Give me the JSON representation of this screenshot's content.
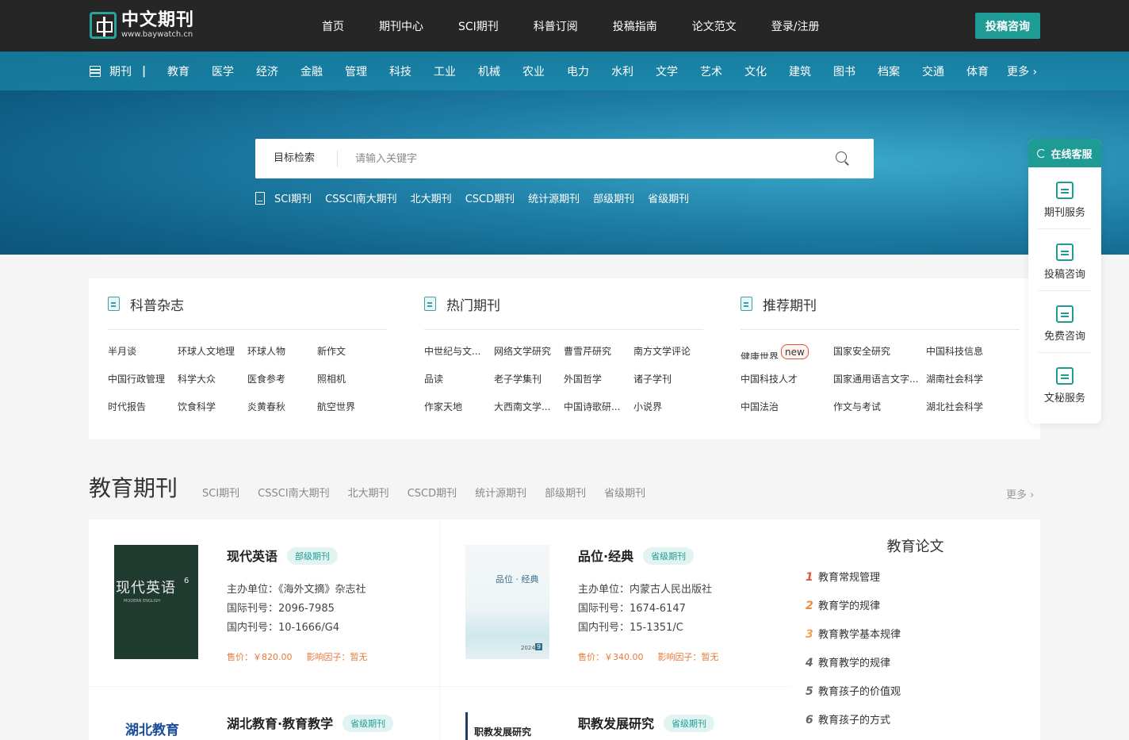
{
  "header": {
    "logo_title": "中文期刊",
    "logo_url": "www.baywatch.cn",
    "nav": [
      "首页",
      "期刊中心",
      "SCI期刊",
      "科普订阅",
      "投稿指南",
      "论文范文",
      "登录/注册"
    ],
    "consult_button": "投稿咨询",
    "accent_color": "#1e9b94"
  },
  "catbar": {
    "head": "期刊",
    "separator": "|",
    "items": [
      "教育",
      "医学",
      "经济",
      "金融",
      "管理",
      "科技",
      "工业",
      "机械",
      "农业",
      "电力",
      "水利",
      "文学",
      "艺术",
      "文化",
      "建筑",
      "图书",
      "档案",
      "交通",
      "体育"
    ],
    "more": "更多 ›"
  },
  "search": {
    "label": "目标检索",
    "placeholder": "请输入关键字",
    "quick_links": [
      "SCI期刊",
      "CSSCI南大期刊",
      "北大期刊",
      "CSCD期刊",
      "统计源期刊",
      "部级期刊",
      "省级期刊"
    ]
  },
  "columns": [
    {
      "title": "科普杂志",
      "items": [
        "半月谈",
        "环球人文地理",
        "环球人物",
        "新作文",
        "中国行政管理",
        "科学大众",
        "医食参考",
        "照相机",
        "时代报告",
        "饮食科学",
        "炎黄春秋",
        "航空世界"
      ]
    },
    {
      "title": "热门期刊",
      "items": [
        "中世纪与文...",
        "网络文学研究",
        "曹雪芹研究",
        "南方文学评论",
        "品读",
        "老子学集刊",
        "外国哲学",
        "诸子学刊",
        "作家天地",
        "大西南文学...",
        "中国诗歌研...",
        "小说界"
      ]
    },
    {
      "title": "推荐期刊",
      "items": [
        "健康世界",
        "国家安全研究",
        "中国科技信息",
        "中国科技人才",
        "国家通用语言文字...",
        "湖南社会科学",
        "中国法治",
        "作文与考试",
        "湖北社会科学"
      ],
      "new_badge": "new"
    }
  ],
  "section": {
    "title": "教育期刊",
    "tabs": [
      "SCI期刊",
      "CSSCI南大期刊",
      "北大期刊",
      "CSCD期刊",
      "统计源期刊",
      "部级期刊",
      "省级期刊"
    ],
    "more": "更多 ›"
  },
  "journals": [
    {
      "name": "现代英语",
      "tag": "部级期刊",
      "sponsor": "主办单位：《海外文摘》杂志社",
      "issn": "国际刊号：2096-7985",
      "cn": "国内刊号：10-1666/G4",
      "price": "售价：￥820.00",
      "impact": "影响因子：暂无",
      "cover_title": "现代英语",
      "cover_issue": "6",
      "cover_sub": "MODERN ENGLISH"
    },
    {
      "name": "品位·经典",
      "tag": "省级期刊",
      "sponsor": "主办单位：内蒙古人民出版社",
      "issn": "国际刊号：1674-6147",
      "cn": "国内刊号：15-1351/C",
      "price": "售价：￥340.00",
      "impact": "影响因子：暂无",
      "cover_title": "品位 · 经典",
      "cover_year": "2024",
      "cover_issue": "9"
    },
    {
      "name": "湖北教育·教育教学",
      "tag": "省级期刊",
      "cover_title": "湖北教育"
    },
    {
      "name": "职教发展研究",
      "tag": "省级期刊",
      "cover_title": "职教发展研究"
    }
  ],
  "papers": {
    "title": "教育论文",
    "items": [
      {
        "num": "1",
        "text": "教育常规管理"
      },
      {
        "num": "2",
        "text": "教育学的规律"
      },
      {
        "num": "3",
        "text": "教育教学基本规律"
      },
      {
        "num": "4",
        "text": "教育教学的规律"
      },
      {
        "num": "5",
        "text": "教育孩子的价值观"
      },
      {
        "num": "6",
        "text": "教育孩子的方式"
      }
    ]
  },
  "float_service": {
    "head": "在线客服",
    "items": [
      "期刊服务",
      "投稿咨询",
      "免费咨询",
      "文秘服务"
    ]
  }
}
